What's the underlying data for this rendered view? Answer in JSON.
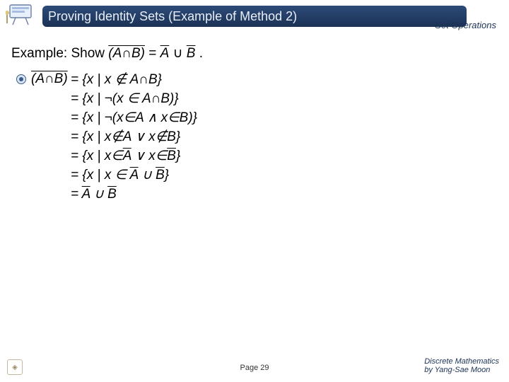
{
  "header": {
    "title": "Proving Identity Sets (Example of Method 2)",
    "section": "Set Operations"
  },
  "example": {
    "prefix": "Example: Show ",
    "lhs_over": "(A∩B)",
    "eq": "=",
    "rhs_a_over": "A",
    "rhs_cup": " ∪ ",
    "rhs_b_over": "B",
    "period": "."
  },
  "proof": {
    "lhs_over": "(A∩B)",
    "steps": [
      {
        "pre": "= {x | x ∉ A∩B}",
        "over1": "",
        "mid": "",
        "over2": "",
        "post": ""
      },
      {
        "pre": "= {x | ¬(x ∈ A∩B)}",
        "over1": "",
        "mid": "",
        "over2": "",
        "post": ""
      },
      {
        "pre": "= {x | ¬(x∈A ∧ x∈B)}",
        "over1": "",
        "mid": "",
        "over2": "",
        "post": ""
      },
      {
        "pre": "= {x | x∉A ∨ x∉B}",
        "over1": "",
        "mid": "",
        "over2": "",
        "post": ""
      },
      {
        "pre": "= {x | x∈",
        "over1": "A",
        "mid": " ∨ x∈",
        "over2": "B",
        "post": "}"
      },
      {
        "pre": "= {x | x ∈ ",
        "over1": "A",
        "mid": " ∪ ",
        "over2": "B",
        "post": "}"
      },
      {
        "pre": "= ",
        "over1": "A",
        "mid": " ∪ ",
        "over2": "B",
        "post": ""
      }
    ]
  },
  "footer": {
    "page": "Page 29",
    "credit_line1": "Discrete Mathematics",
    "credit_line2": "by Yang-Sae Moon"
  },
  "icons": {
    "corner": "presentation-board-icon",
    "bullet": "seal-icon",
    "footer_logo": "university-seal-icon"
  }
}
